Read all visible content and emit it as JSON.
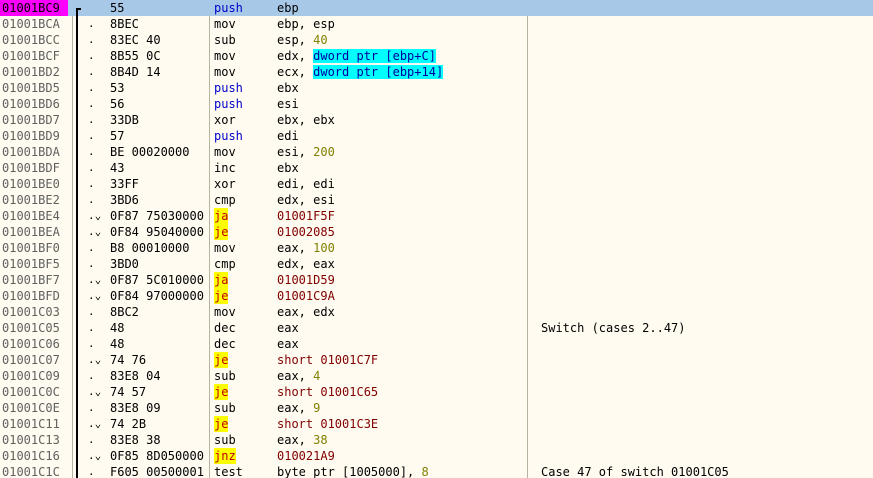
{
  "rows": [
    {
      "addr": "01001BC9",
      "jmp": "top",
      "mark": "",
      "hex": "55",
      "mnem": "push",
      "mtype": "push",
      "ops": [
        {
          "t": "ebp",
          "c": "reg"
        }
      ],
      "comment": "",
      "selected": true
    },
    {
      "addr": "01001BCA",
      "jmp": "mid",
      "mark": ".",
      "hex": "8BEC",
      "mnem": "mov",
      "mtype": "",
      "ops": [
        {
          "t": "ebp, esp",
          "c": "reg"
        }
      ],
      "comment": ""
    },
    {
      "addr": "01001BCC",
      "jmp": "mid",
      "mark": ".",
      "hex": "83EC 40",
      "mnem": "sub",
      "mtype": "",
      "ops": [
        {
          "t": "esp, ",
          "c": "reg"
        },
        {
          "t": "40",
          "c": "num"
        }
      ],
      "comment": ""
    },
    {
      "addr": "01001BCF",
      "jmp": "mid",
      "mark": ".",
      "hex": "8B55 0C",
      "mnem": "mov",
      "mtype": "",
      "ops": [
        {
          "t": "edx, ",
          "c": "reg"
        },
        {
          "t": "dword ptr [ebp+C]",
          "c": "mem"
        }
      ],
      "comment": ""
    },
    {
      "addr": "01001BD2",
      "jmp": "mid",
      "mark": ".",
      "hex": "8B4D 14",
      "mnem": "mov",
      "mtype": "",
      "ops": [
        {
          "t": "ecx, ",
          "c": "reg"
        },
        {
          "t": "dword ptr [ebp+14]",
          "c": "mem"
        }
      ],
      "comment": ""
    },
    {
      "addr": "01001BD5",
      "jmp": "mid",
      "mark": ".",
      "hex": "53",
      "mnem": "push",
      "mtype": "push",
      "ops": [
        {
          "t": "ebx",
          "c": "reg"
        }
      ],
      "comment": ""
    },
    {
      "addr": "01001BD6",
      "jmp": "mid",
      "mark": ".",
      "hex": "56",
      "mnem": "push",
      "mtype": "push",
      "ops": [
        {
          "t": "esi",
          "c": "reg"
        }
      ],
      "comment": ""
    },
    {
      "addr": "01001BD7",
      "jmp": "mid",
      "mark": ".",
      "hex": "33DB",
      "mnem": "xor",
      "mtype": "",
      "ops": [
        {
          "t": "ebx, ebx",
          "c": "reg"
        }
      ],
      "comment": ""
    },
    {
      "addr": "01001BD9",
      "jmp": "mid",
      "mark": ".",
      "hex": "57",
      "mnem": "push",
      "mtype": "push",
      "ops": [
        {
          "t": "edi",
          "c": "reg"
        }
      ],
      "comment": ""
    },
    {
      "addr": "01001BDA",
      "jmp": "mid",
      "mark": ".",
      "hex": "BE 00020000",
      "mnem": "mov",
      "mtype": "",
      "ops": [
        {
          "t": "esi, ",
          "c": "reg"
        },
        {
          "t": "200",
          "c": "num"
        }
      ],
      "comment": ""
    },
    {
      "addr": "01001BDF",
      "jmp": "mid",
      "mark": ".",
      "hex": "43",
      "mnem": "inc",
      "mtype": "",
      "ops": [
        {
          "t": "ebx",
          "c": "reg"
        }
      ],
      "comment": ""
    },
    {
      "addr": "01001BE0",
      "jmp": "mid",
      "mark": ".",
      "hex": "33FF",
      "mnem": "xor",
      "mtype": "",
      "ops": [
        {
          "t": "edi, edi",
          "c": "reg"
        }
      ],
      "comment": ""
    },
    {
      "addr": "01001BE2",
      "jmp": "mid",
      "mark": ".",
      "hex": "3BD6",
      "mnem": "cmp",
      "mtype": "",
      "ops": [
        {
          "t": "edx, esi",
          "c": "reg"
        }
      ],
      "comment": ""
    },
    {
      "addr": "01001BE4",
      "jmp": "mid",
      "mark": ".⌄",
      "hex": "0F87 75030000",
      "mnem": "ja",
      "mtype": "jcc",
      "ops": [
        {
          "t": "01001F5F",
          "c": "addr"
        }
      ],
      "comment": ""
    },
    {
      "addr": "01001BEA",
      "jmp": "mid",
      "mark": ".⌄",
      "hex": "0F84 95040000",
      "mnem": "je",
      "mtype": "jcc",
      "ops": [
        {
          "t": "01002085",
          "c": "addr"
        }
      ],
      "comment": ""
    },
    {
      "addr": "01001BF0",
      "jmp": "mid",
      "mark": ".",
      "hex": "B8 00010000",
      "mnem": "mov",
      "mtype": "",
      "ops": [
        {
          "t": "eax, ",
          "c": "reg"
        },
        {
          "t": "100",
          "c": "num"
        }
      ],
      "comment": ""
    },
    {
      "addr": "01001BF5",
      "jmp": "mid",
      "mark": ".",
      "hex": "3BD0",
      "mnem": "cmp",
      "mtype": "",
      "ops": [
        {
          "t": "edx, eax",
          "c": "reg"
        }
      ],
      "comment": ""
    },
    {
      "addr": "01001BF7",
      "jmp": "mid",
      "mark": ".⌄",
      "hex": "0F87 5C010000",
      "mnem": "ja",
      "mtype": "jcc",
      "ops": [
        {
          "t": "01001D59",
          "c": "addr"
        }
      ],
      "comment": ""
    },
    {
      "addr": "01001BFD",
      "jmp": "mid",
      "mark": ".⌄",
      "hex": "0F84 97000000",
      "mnem": "je",
      "mtype": "jcc",
      "ops": [
        {
          "t": "01001C9A",
          "c": "addr"
        }
      ],
      "comment": ""
    },
    {
      "addr": "01001C03",
      "jmp": "mid",
      "mark": ".",
      "hex": "8BC2",
      "mnem": "mov",
      "mtype": "",
      "ops": [
        {
          "t": "eax, edx",
          "c": "reg"
        }
      ],
      "comment": ""
    },
    {
      "addr": "01001C05",
      "jmp": "mid",
      "mark": ".",
      "hex": "48",
      "mnem": "dec",
      "mtype": "",
      "ops": [
        {
          "t": "eax",
          "c": "reg"
        }
      ],
      "comment": "Switch (cases 2..47)"
    },
    {
      "addr": "01001C06",
      "jmp": "mid",
      "mark": ".",
      "hex": "48",
      "mnem": "dec",
      "mtype": "",
      "ops": [
        {
          "t": "eax",
          "c": "reg"
        }
      ],
      "comment": ""
    },
    {
      "addr": "01001C07",
      "jmp": "mid",
      "mark": ".⌄",
      "hex": "74 76",
      "mnem": "je",
      "mtype": "jcc",
      "ops": [
        {
          "t": "short 01001C7F",
          "c": "short"
        }
      ],
      "comment": ""
    },
    {
      "addr": "01001C09",
      "jmp": "mid",
      "mark": ".",
      "hex": "83E8 04",
      "mnem": "sub",
      "mtype": "",
      "ops": [
        {
          "t": "eax, ",
          "c": "reg"
        },
        {
          "t": "4",
          "c": "num"
        }
      ],
      "comment": ""
    },
    {
      "addr": "01001C0C",
      "jmp": "mid",
      "mark": ".⌄",
      "hex": "74 57",
      "mnem": "je",
      "mtype": "jcc",
      "ops": [
        {
          "t": "short 01001C65",
          "c": "short"
        }
      ],
      "comment": ""
    },
    {
      "addr": "01001C0E",
      "jmp": "mid",
      "mark": ".",
      "hex": "83E8 09",
      "mnem": "sub",
      "mtype": "",
      "ops": [
        {
          "t": "eax, ",
          "c": "reg"
        },
        {
          "t": "9",
          "c": "num"
        }
      ],
      "comment": ""
    },
    {
      "addr": "01001C11",
      "jmp": "mid",
      "mark": ".⌄",
      "hex": "74 2B",
      "mnem": "je",
      "mtype": "jcc",
      "ops": [
        {
          "t": "short 01001C3E",
          "c": "short"
        }
      ],
      "comment": ""
    },
    {
      "addr": "01001C13",
      "jmp": "mid",
      "mark": ".",
      "hex": "83E8 38",
      "mnem": "sub",
      "mtype": "",
      "ops": [
        {
          "t": "eax, ",
          "c": "reg"
        },
        {
          "t": "38",
          "c": "num"
        }
      ],
      "comment": ""
    },
    {
      "addr": "01001C16",
      "jmp": "mid",
      "mark": ".⌄",
      "hex": "0F85 8D050000",
      "mnem": "jnz",
      "mtype": "jcc",
      "ops": [
        {
          "t": "010021A9",
          "c": "addr"
        }
      ],
      "comment": ""
    },
    {
      "addr": "01001C1C",
      "jmp": "mid",
      "mark": ".",
      "hex": "F605 00500001 08",
      "mnem": "test",
      "mtype": "",
      "ops": [
        {
          "t": "byte ptr [1005000], ",
          "c": "reg"
        },
        {
          "t": "8",
          "c": "num"
        }
      ],
      "comment": "Case 47 of switch 01001C05"
    }
  ]
}
